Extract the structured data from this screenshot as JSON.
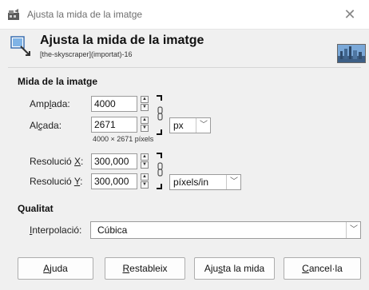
{
  "window": {
    "title": "Ajusta la mida de la imatge",
    "close_glyph": "✕"
  },
  "header": {
    "title": "Ajusta la mida de la imatge",
    "subtitle": "[the-skyscraper](importat)-16"
  },
  "image_size": {
    "section_label": "Mida de la imatge",
    "width": {
      "label_pre": "Amp",
      "label_u": "l",
      "label_post": "ada:",
      "value": "4000"
    },
    "height": {
      "label_pre": "Al",
      "label_u": "ç",
      "label_post": "ada:",
      "value": "2671"
    },
    "unit": "px",
    "pixels_note": "4000 × 2671 píxels",
    "res_x": {
      "label_pre": "Resolució ",
      "label_u": "X",
      "label_post": ":",
      "value": "300,000"
    },
    "res_y": {
      "label_pre": "Resolució ",
      "label_u": "Y",
      "label_post": ":",
      "value": "300,000"
    },
    "res_unit": "píxels/in"
  },
  "quality": {
    "section_label": "Qualitat",
    "interp_label_u": "I",
    "interp_label_post": "nterpolació:",
    "interp_value": "Cúbica"
  },
  "buttons": {
    "help": {
      "u": "A",
      "post": "juda"
    },
    "reset": {
      "u": "R",
      "post": "estableix"
    },
    "resize": {
      "pre": "Aju",
      "u": "s",
      "post": "ta la mida"
    },
    "cancel": {
      "u": "C",
      "post": "ancel·la"
    }
  },
  "icons": {
    "app": "gimp-app-icon",
    "header": "resize-image-icon",
    "chain": "chain-link-icon",
    "dropdown": "chevron-down-icon",
    "spin_up": "spin-up-icon",
    "spin_down": "spin-down-icon"
  }
}
